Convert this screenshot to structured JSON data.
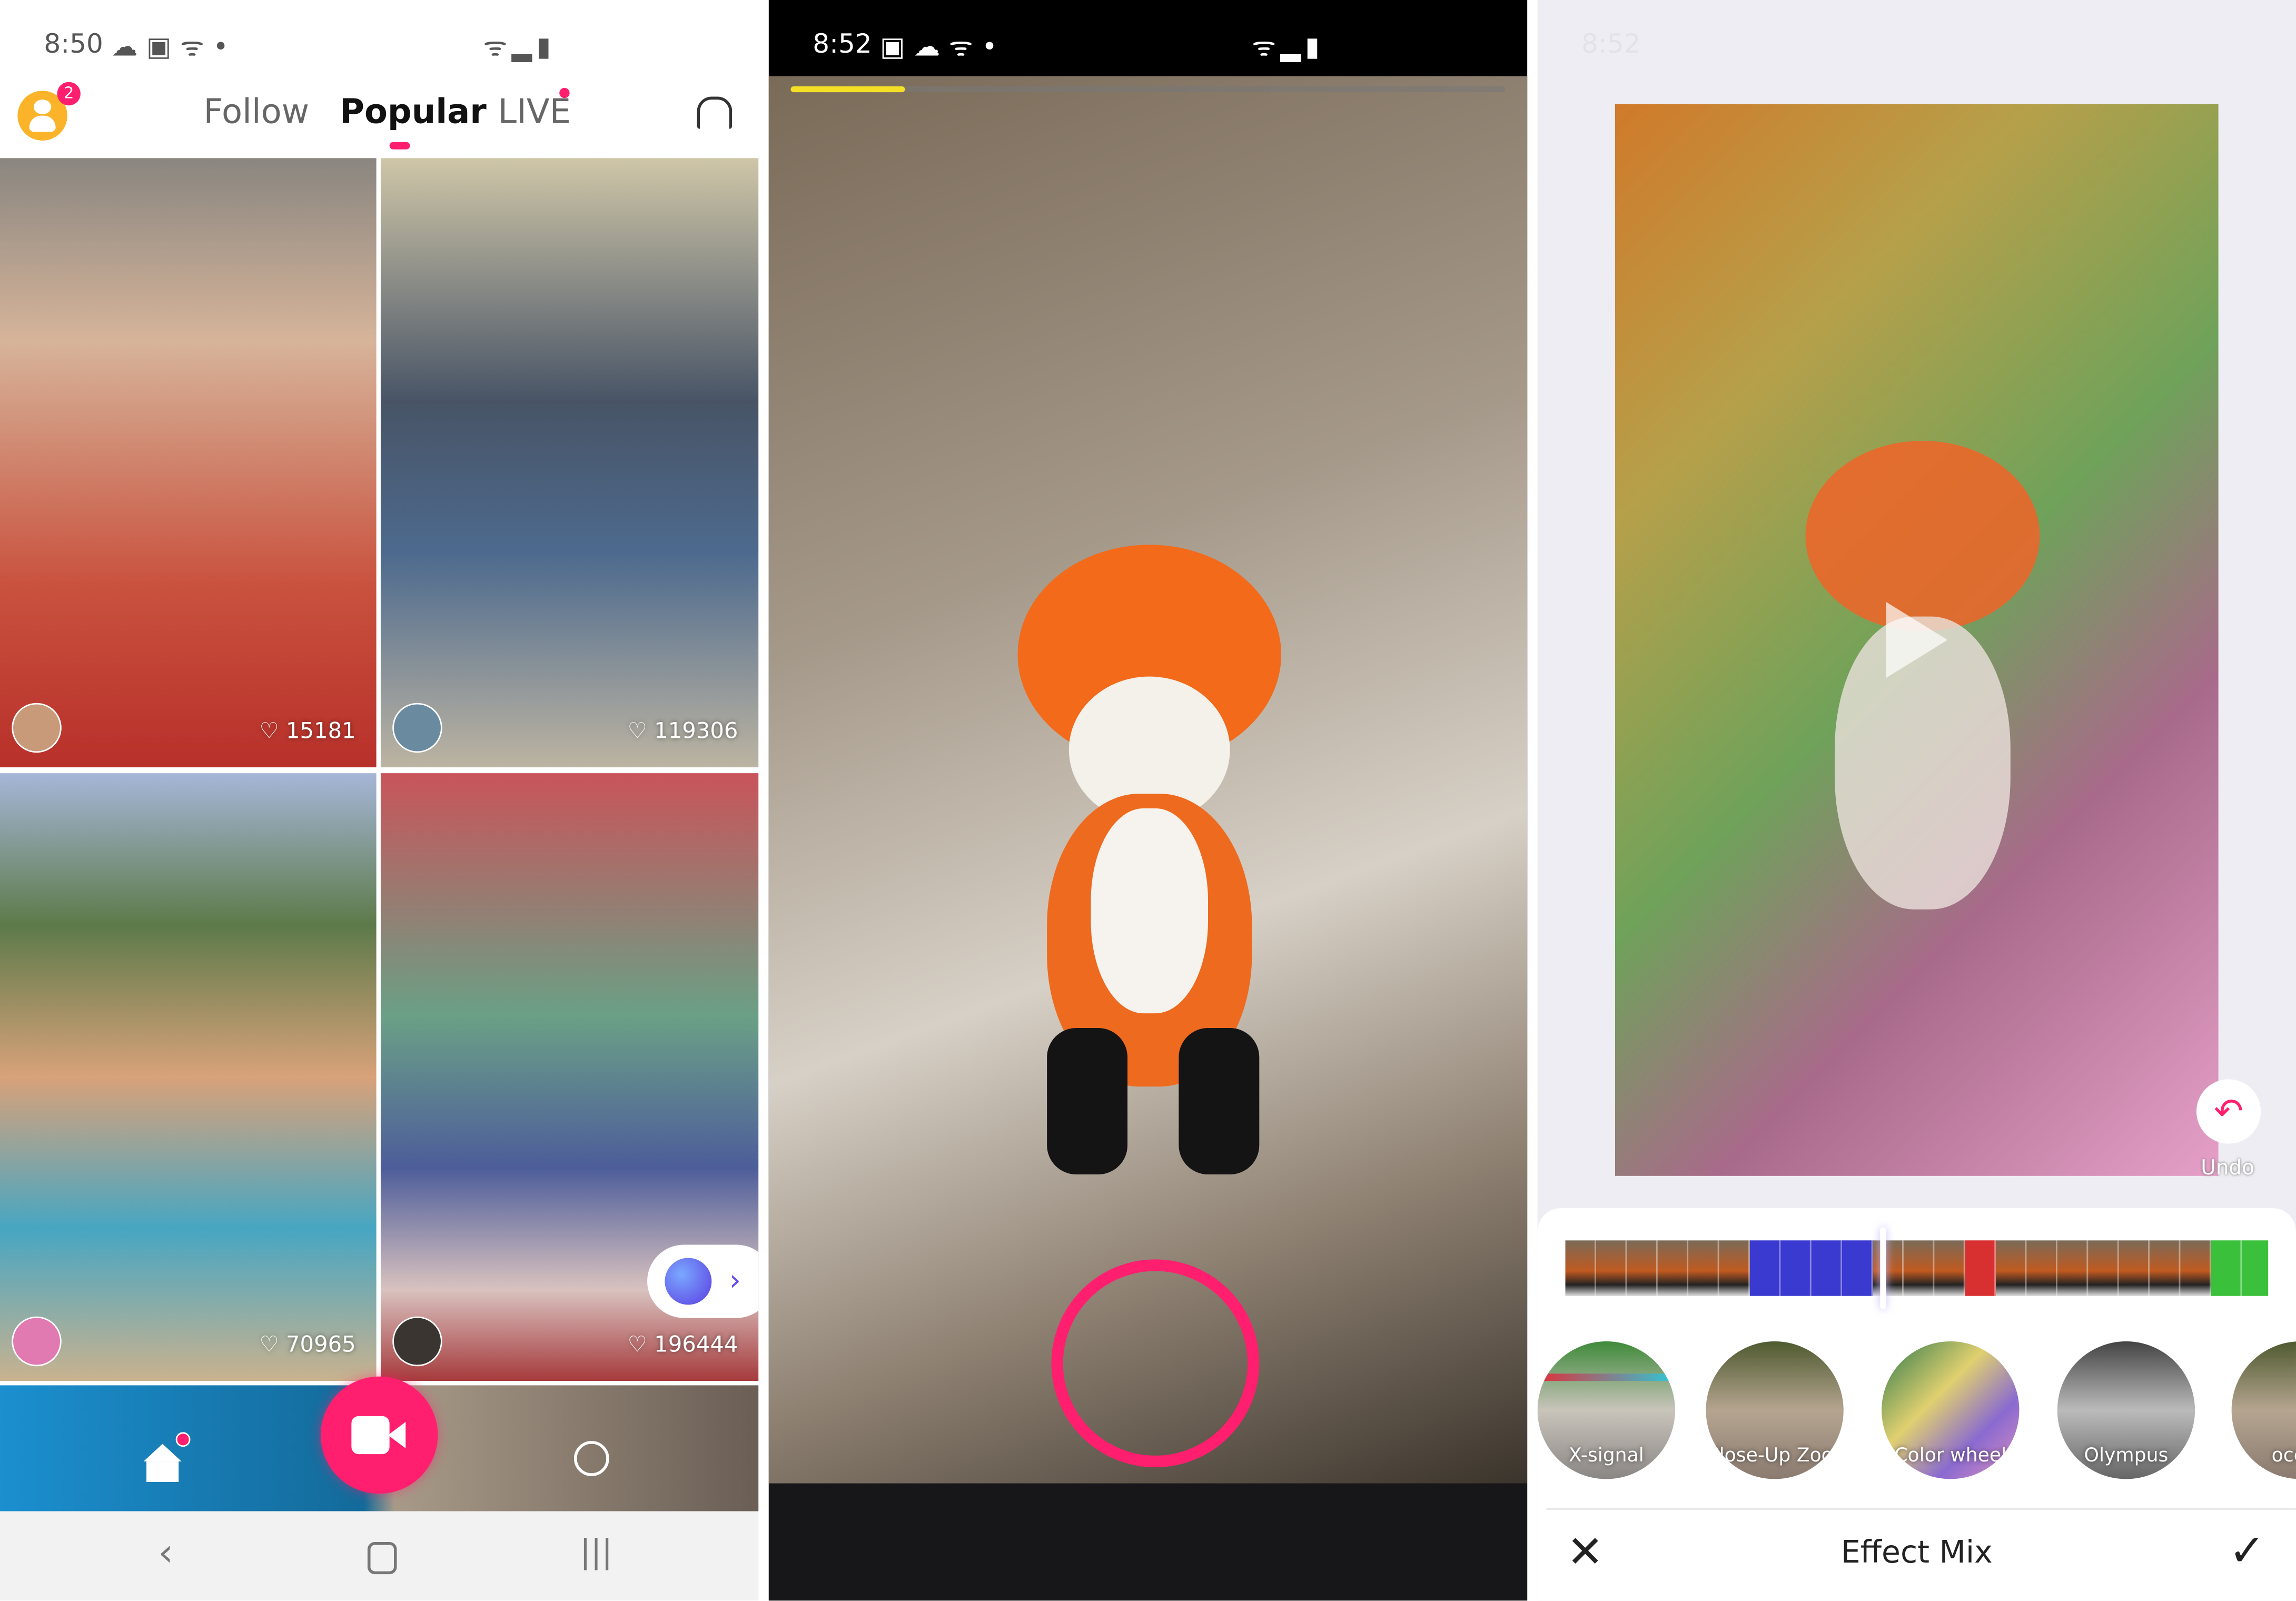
{
  "panel1": {
    "status": {
      "time": "8:50"
    },
    "header": {
      "badge_count": "2",
      "tabs": [
        {
          "label": "Follow"
        },
        {
          "label": "Popular",
          "active": true
        },
        {
          "label": "LIVE"
        }
      ]
    },
    "feed": [
      {
        "likes": "15181"
      },
      {
        "likes": "119306"
      },
      {
        "likes": "70965"
      },
      {
        "likes": "196444"
      }
    ],
    "bottom_nav": [
      "home-icon",
      "record-video-icon",
      "search-icon"
    ],
    "system_nav": [
      "back",
      "home",
      "recents"
    ]
  },
  "panel2": {
    "status": {
      "time": "8:52"
    },
    "progress_percent": 16,
    "record_color": "#ff1f6e"
  },
  "panel3": {
    "status": {
      "time": "8:52"
    },
    "undo_label": "Undo",
    "effects": [
      {
        "label": "X-signal"
      },
      {
        "label": "Close-Up Zoom"
      },
      {
        "label": "Color wheel"
      },
      {
        "label": "Olympus"
      },
      {
        "label": "ocean"
      }
    ],
    "title": "Effect Mix"
  },
  "colors": {
    "accent": "#ff1f6e",
    "avatar": "#fbb42a",
    "progress": "#f5e025"
  }
}
